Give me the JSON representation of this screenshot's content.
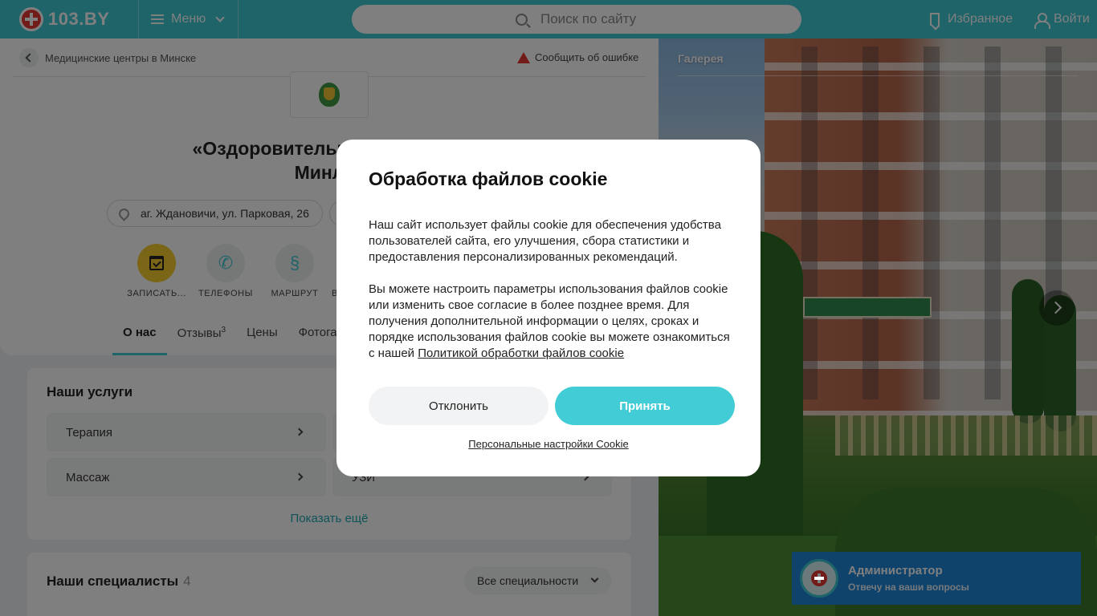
{
  "header": {
    "logo_text": "103.BY",
    "menu_label": "Меню",
    "search_placeholder": "Поиск по сайту",
    "favorites_label": "Избранное",
    "login_label": "Войти"
  },
  "page": {
    "breadcrumb": "Медицинские центры в Минске",
    "report_error": "Сообщить об ошибке",
    "title_line1": "«Оздоровительный комплекс",
    "title_line2": "Минлес",
    "address": "аг. Ждановичи, ул. Парковая, 26",
    "actions": [
      {
        "label": "ЗАПИСАТЬ..."
      },
      {
        "label": "ТЕЛЕФОНЫ"
      },
      {
        "label": "МАРШРУТ"
      },
      {
        "label": "В"
      }
    ],
    "tabs": [
      {
        "label": "О нас"
      },
      {
        "label": "Отзывы",
        "count": "3"
      },
      {
        "label": "Цены"
      },
      {
        "label": "Фотога..."
      }
    ],
    "services": {
      "title": "Наши услуги",
      "items": [
        {
          "label": "Терапия"
        },
        {
          "label": "Массаж"
        },
        {
          "label": "УЗИ"
        }
      ],
      "show_more": "Показать ещё"
    },
    "specialists": {
      "title": "Наши специалисты",
      "count": "4",
      "filter_value": "Все специальности"
    }
  },
  "gallery": {
    "label": "Галерея"
  },
  "admin_widget": {
    "name": "Администратор",
    "subtitle": "Отвечу на ваши вопросы"
  },
  "cookie_modal": {
    "title": "Обработка файлов cookie",
    "paragraph1": "Наш сайт использует файлы cookie для обеспечения удобства пользователей сайта, его улучшения, сбора статистики и предоставления персонализированных рекомендаций.",
    "paragraph2": "Вы можете настроить параметры использования файлов cookie или изменить свое согласие в более позднее время. Для получения дополнительной информации о целях, сроках и порядке использования файлов cookie вы можете ознакомиться с нашей",
    "policy_link": "Политикой обработки файлов cookie",
    "decline_label": "Отклонить",
    "accept_label": "Принять",
    "settings_link": "Персональные настройки Cookie"
  },
  "colors": {
    "brand": "#3ec9d3",
    "accent_yellow": "#f5cc2c",
    "admin_blue": "#1f86d6",
    "alert_red": "#e53935"
  },
  "icons": [
    "search-icon",
    "bookmark-icon",
    "user-icon",
    "menu-icon",
    "chevron-down-icon",
    "back-arrow-icon",
    "warning-icon",
    "location-pin-icon",
    "calendar-check-icon",
    "phone-icon",
    "route-icon",
    "chevron-right-icon"
  ]
}
